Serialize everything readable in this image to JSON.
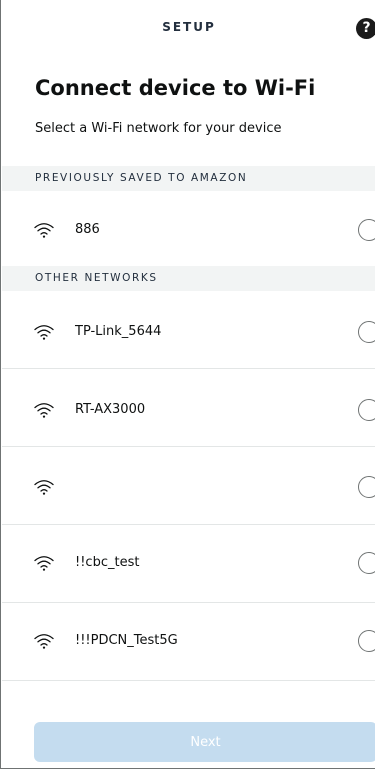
{
  "header": {
    "title": "SETUP",
    "help_symbol": "?"
  },
  "page": {
    "title": "Connect device to Wi-Fi",
    "subtitle": "Select a Wi-Fi network for your device"
  },
  "saved_section": {
    "label": "PREVIOUSLY SAVED TO AMAZON",
    "networks": [
      {
        "ssid": "886",
        "icon": "wifi-icon",
        "selected": false
      }
    ]
  },
  "other_section": {
    "label": "OTHER NETWORKS",
    "networks": [
      {
        "ssid": "TP-Link_5644",
        "icon": "wifi-icon",
        "selected": false
      },
      {
        "ssid": "RT-AX3000",
        "icon": "wifi-icon",
        "selected": false
      },
      {
        "ssid": "",
        "icon": "wifi-icon",
        "selected": false
      },
      {
        "ssid": "!!cbc_test",
        "icon": "wifi-icon",
        "selected": false
      },
      {
        "ssid": "!!!PDCN_Test5G",
        "icon": "wifi-icon",
        "selected": false
      }
    ]
  },
  "footer": {
    "next_label": "Next",
    "next_enabled": false
  },
  "colors": {
    "text": "#0f1111",
    "section_bg": "#f2f4f4",
    "divider": "#e3e6e6",
    "radio_border": "#6f7373",
    "next_disabled_bg": "#c4dcef"
  }
}
